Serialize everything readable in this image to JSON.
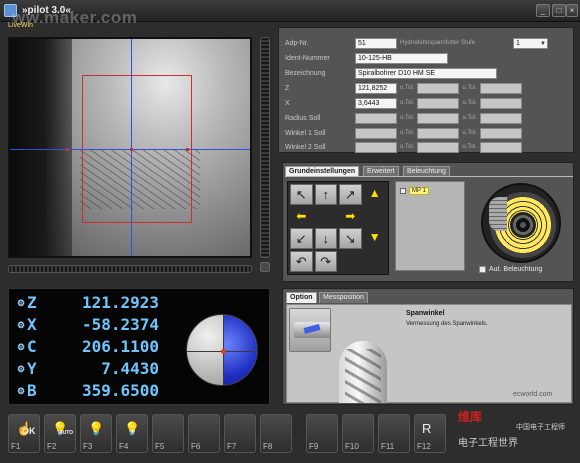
{
  "window": {
    "title": "»pilot 3.0«",
    "watermark": "ww.maker.com"
  },
  "live": {
    "label": "LiveWin"
  },
  "params": {
    "rows": [
      {
        "label": "Adp-Nr.",
        "value": "51",
        "extra_label": "Hydrodehnspannfutter Stufe",
        "extra_value": "1"
      },
      {
        "label": "Ident-Nummer",
        "value": "10-125-HB"
      },
      {
        "label": "Bezeichnung",
        "value": "Spiralbohrer D10 HM SE"
      },
      {
        "label": "Z",
        "value": "121,8252",
        "sub1": "o.Tol.",
        "sub2": "u.Tol."
      },
      {
        "label": "X",
        "value": "3,6443",
        "sub1": "o.Tol.",
        "sub2": "u.Tol."
      },
      {
        "label": "Radius Soll",
        "value": "",
        "sub1": "o.Tol.",
        "sub2": "u.Tol."
      },
      {
        "label": "Winkel 1 Soll",
        "value": "",
        "sub1": "o.Tol.",
        "sub2": "u.Tol."
      },
      {
        "label": "Winkel 2 Soll",
        "value": "",
        "sub1": "o.Tol.",
        "sub2": "u.Tol."
      }
    ]
  },
  "settings_tabs": [
    "Grundeinstellungen",
    "Erweitert",
    "Beleuchtung"
  ],
  "measure_point": {
    "label": "MP 1"
  },
  "auto_light_label": "Aut. Beleuchtung",
  "readout": [
    {
      "axis": "Z",
      "value": "121.2923"
    },
    {
      "axis": "X",
      "value": "-58.2374"
    },
    {
      "axis": "C",
      "value": "206.1100"
    },
    {
      "axis": "Y",
      "value": "7.4430"
    },
    {
      "axis": "B",
      "value": "359.6500"
    }
  ],
  "info": {
    "tabs": [
      "Option",
      "Messposition"
    ],
    "title": "Spanwinkel",
    "description": "Vermessung des Spanwinkels.",
    "watermark": "ecworld.com"
  },
  "fkeys": [
    "F1",
    "F2",
    "F3",
    "F4",
    "F5",
    "F6",
    "F7",
    "F8",
    "F9",
    "F10",
    "F11",
    "F12"
  ],
  "fkey_icons": {
    "ok": "OK",
    "auto": "AUTO",
    "minus": "-",
    "plus": "+",
    "f12": "R"
  },
  "bottom_watermark": {
    "line1": "维库",
    "line2": "中国电子工程师",
    "line3": "电子工程世界"
  }
}
